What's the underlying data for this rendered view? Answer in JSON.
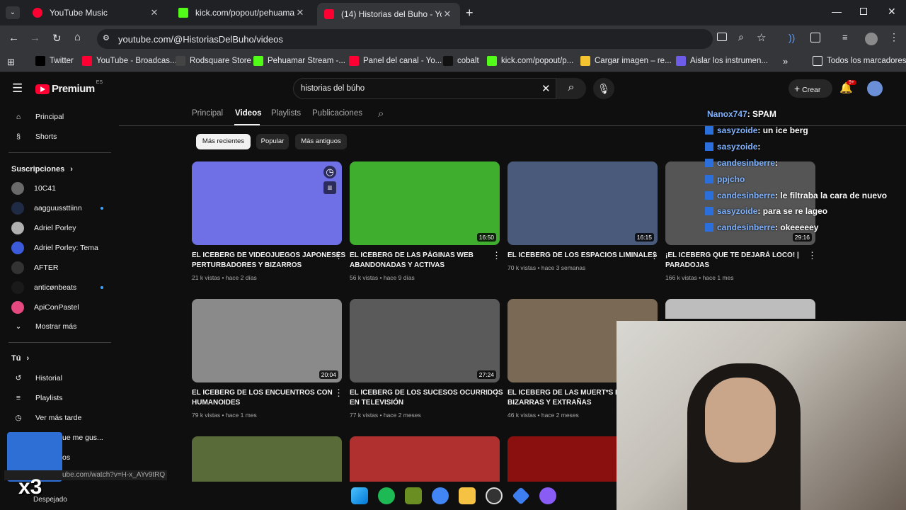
{
  "tabs": [
    {
      "title": "YouTube Music",
      "color": "#ff0033"
    },
    {
      "title": "kick.com/popout/pehuamar/ch",
      "color": "#53fc18"
    },
    {
      "title": "(14) Historias del Buho - YouTu",
      "color": "#ff0033"
    }
  ],
  "address": "youtube.com/@HistoriasDelBuho/videos",
  "bookmarks": [
    {
      "label": "Twitter",
      "color": "#000000"
    },
    {
      "label": "YouTube - Broadcas...",
      "color": "#ff0033"
    },
    {
      "label": "Rodsquare Store",
      "color": "#444444"
    },
    {
      "label": "Pehuamar Stream -...",
      "color": "#53fc18"
    },
    {
      "label": "Panel del canal - Yo...",
      "color": "#ff0033"
    },
    {
      "label": "cobalt",
      "color": "#111111"
    },
    {
      "label": "kick.com/popout/p...",
      "color": "#53fc18"
    },
    {
      "label": "Cargar imagen – re...",
      "color": "#f4c430"
    },
    {
      "label": "Aislar los instrumen...",
      "color": "#6c5ce7"
    }
  ],
  "all_bookmarks": "Todos los marcadores",
  "yt": {
    "logo": "Premium",
    "region": "ES",
    "search_value": "historias del búho",
    "create_label": "Crear",
    "notif_count": "9+",
    "nav": {
      "home": "Principal",
      "shorts": "Shorts"
    },
    "subs_header": "Suscripciones",
    "subs": [
      {
        "name": "10C41",
        "color": "#6a6a6a",
        "live": false
      },
      {
        "name": "aagguussttiinn",
        "color": "#1f2a44",
        "live": true
      },
      {
        "name": "Adriel Porley",
        "color": "#b0b0b0",
        "live": false
      },
      {
        "name": "Adriel Porley: Tema",
        "color": "#3b5bdb",
        "live": false
      },
      {
        "name": "AFTER",
        "color": "#333333",
        "live": false
      },
      {
        "name": "anticønbeats",
        "color": "#1a1a1a",
        "live": true
      },
      {
        "name": "ApiConPastel",
        "color": "#e64980",
        "live": false
      }
    ],
    "show_more": "Mostrar más",
    "you_header": "Tú",
    "you": {
      "history": "Historial",
      "playlists": "Playlists",
      "later": "Ver más tarde",
      "liked": "ue me gus...",
      "other": "os"
    },
    "channel_tabs": [
      "Principal",
      "Videos",
      "Playlists",
      "Publicaciones"
    ],
    "filters": [
      "Más recientes",
      "Popular",
      "Más antiguos"
    ],
    "videos": [
      {
        "t1": "EL ICEBERG DE VIDEOJUEGOS JAPONESES",
        "t2": "PERTURBADORES Y BIZARROS",
        "meta": "21 k vistas • hace 2 días",
        "dur": "",
        "thumb": "#6f6fe6"
      },
      {
        "t1": "EL ICEBERG DE LAS PÁGINAS WEB",
        "t2": "ABANDONADAS Y ACTIVAS",
        "meta": "56 k vistas • hace 9 días",
        "dur": "16:50",
        "thumb": "#3fae2f"
      },
      {
        "t1": "EL ICEBERG DE LOS ESPACIOS LIMINALES",
        "t2": "",
        "meta": "70 k vistas • hace 3 semanas",
        "dur": "16:15",
        "thumb": "#4a5a7a"
      },
      {
        "t1": "¡EL ICEBERG QUE TE DEJARÁ LOCO! |",
        "t2": "PARADOJAS",
        "meta": "166 k vistas • hace 1 mes",
        "dur": "29:16",
        "thumb": "#555555"
      },
      {
        "t1": "EL ICEBERG DE LOS ENCUENTROS CON",
        "t2": "HUMANOIDES",
        "meta": "79 k vistas • hace 1 mes",
        "dur": "20:04",
        "thumb": "#8a8a8a"
      },
      {
        "t1": "EL ICEBERG DE LOS SUCESOS OCURRIDOS",
        "t2": "EN TELEVISIÓN",
        "meta": "77 k vistas • hace 2 meses",
        "dur": "27:24",
        "thumb": "#5a5a5a"
      },
      {
        "t1": "EL ICEBERG DE LAS MUERT*S MÁS",
        "t2": "BIZARRAS Y EXTRAÑAS",
        "meta": "46 k vistas • hace 2 meses",
        "dur": "",
        "thumb": "#7a6a55"
      }
    ],
    "chat": [
      {
        "user": "Nanox747",
        "msg": ": SPAM"
      },
      {
        "user": "sasyzoide",
        "msg": ": un ice berg"
      },
      {
        "user": "sasyzoide",
        "msg": ":"
      },
      {
        "user": "candesinberre",
        "msg": ":"
      },
      {
        "user": "ppjcho",
        "msg": ""
      },
      {
        "user": "candesinberre",
        "msg": ": le filtraba la cara de nuevo"
      },
      {
        "user": "sasyzoide",
        "msg": ": para se re lageo"
      },
      {
        "user": "candesinberre",
        "msg": ": okeeeeey"
      }
    ],
    "status_url": "ube.com/watch?v=H-x_AYv9tRQ",
    "weather": "Despejado",
    "overlay_text": "x3"
  }
}
